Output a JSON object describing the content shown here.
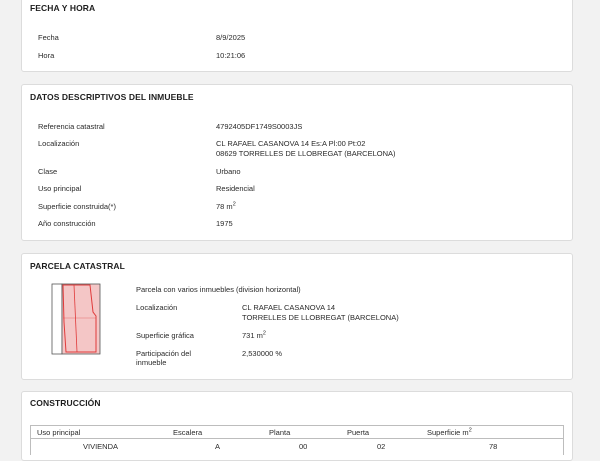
{
  "fecha_hora": {
    "title": "FECHA Y HORA",
    "fecha_label": "Fecha",
    "fecha_value": "8/9/2025",
    "hora_label": "Hora",
    "hora_value": "10:21:06"
  },
  "datos": {
    "title": "DATOS DESCRIPTIVOS DEL INMUEBLE",
    "ref_label": "Referencia catastral",
    "ref_value": "4792405DF1749S0003JS",
    "loc_label": "Localización",
    "loc_value_1": "CL RAFAEL CASANOVA 14 Es:A Pl:00 Pt:02",
    "loc_value_2": "08629 TORRELLES DE LLOBREGAT (BARCELONA)",
    "clase_label": "Clase",
    "clase_value": "Urbano",
    "uso_label": "Uso principal",
    "uso_value": "Residencial",
    "sup_label": "Superficie construida(*)",
    "sup_value": "78 m",
    "sup_unit_exp": "2",
    "anio_label": "Año construcción",
    "anio_value": "1975"
  },
  "parcela": {
    "title": "PARCELA CATASTRAL",
    "desc": "Parcela con varios inmuebles (division horizontal)",
    "loc_label": "Localización",
    "loc_value_1": "CL RAFAEL CASANOVA 14",
    "loc_value_2": "TORRELLES DE LLOBREGAT (BARCELONA)",
    "sup_label": "Superficie gráfica",
    "sup_value": "731 m",
    "sup_unit_exp": "2",
    "part_label_1": "Participación del",
    "part_label_2": "inmueble",
    "part_value": "2,530000 %"
  },
  "construccion": {
    "title": "CONSTRUCCIÓN",
    "headers": {
      "uso": "Uso principal",
      "escalera": "Escalera",
      "planta": "Planta",
      "puerta": "Puerta",
      "superficie": "Superficie m",
      "superficie_exp": "2"
    },
    "rows": [
      {
        "uso": "VIVIENDA",
        "escalera": "A",
        "planta": "00",
        "puerta": "02",
        "superficie": "78"
      }
    ]
  },
  "colors": {
    "card_bg": "#ffffff",
    "page_bg": "#f2f2f2",
    "parcel_fill": "#f4c6c6",
    "parcel_highlight": "#e03a3a",
    "parcel_outline": "#555555"
  }
}
